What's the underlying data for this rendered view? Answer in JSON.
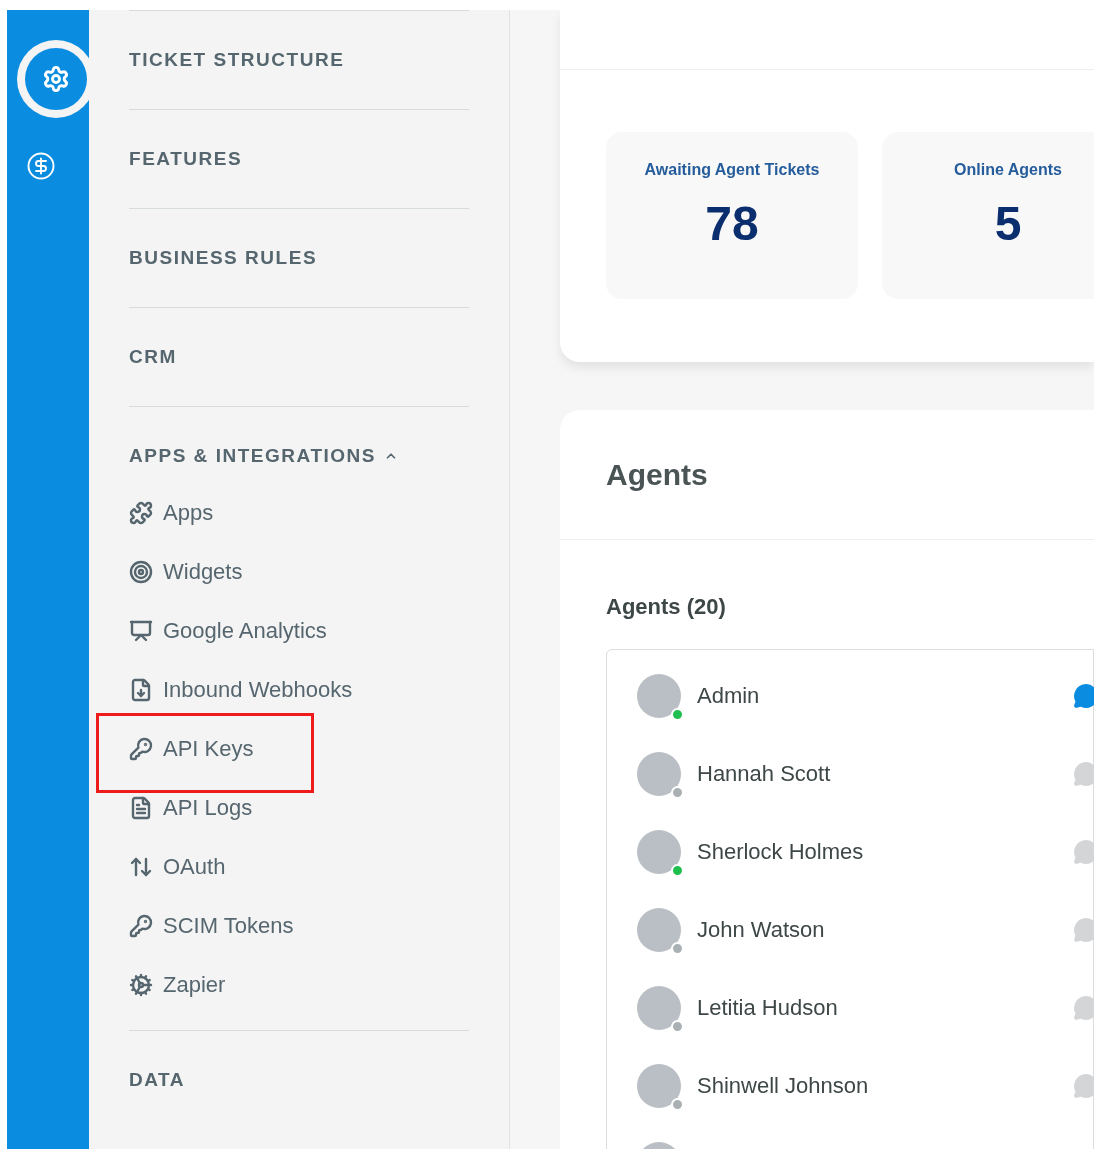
{
  "rail": {
    "items": [
      {
        "kind": "settings",
        "selected": true
      },
      {
        "kind": "billing",
        "selected": false
      }
    ]
  },
  "sidebar": {
    "sections": [
      {
        "title": "TICKET STRUCTURE",
        "expanded": false
      },
      {
        "title": "FEATURES",
        "expanded": false
      },
      {
        "title": "BUSINESS RULES",
        "expanded": false
      },
      {
        "title": "CRM",
        "expanded": false
      },
      {
        "title": "APPS & INTEGRATIONS",
        "expanded": true,
        "children": [
          {
            "label": "Apps",
            "kind": "puzzle",
            "highlighted": false
          },
          {
            "label": "Widgets",
            "kind": "widget",
            "highlighted": false
          },
          {
            "label": "Google Analytics",
            "kind": "chart",
            "highlighted": false
          },
          {
            "label": "Inbound Webhooks",
            "kind": "inbox",
            "highlighted": false
          },
          {
            "label": "API Keys",
            "kind": "key",
            "highlighted": true
          },
          {
            "label": "API Logs",
            "kind": "file",
            "highlighted": false
          },
          {
            "label": "OAuth",
            "kind": "arrows",
            "highlighted": false
          },
          {
            "label": "SCIM Tokens",
            "kind": "key",
            "highlighted": false
          },
          {
            "label": "Zapier",
            "kind": "gear",
            "highlighted": false
          }
        ]
      },
      {
        "title": "DATA",
        "expanded": false
      }
    ]
  },
  "stats": [
    {
      "label": "Awaiting Agent Tickets",
      "value": "78"
    },
    {
      "label": "Online Agents",
      "value": "5"
    }
  ],
  "agents_panel": {
    "title": "Agents",
    "list_title": "Agents (20)",
    "agents": [
      {
        "name": "Admin",
        "online": true,
        "chat_active": true
      },
      {
        "name": "Hannah Scott",
        "online": false,
        "chat_active": false
      },
      {
        "name": "Sherlock Holmes",
        "online": true,
        "chat_active": false
      },
      {
        "name": "John Watson",
        "online": false,
        "chat_active": false
      },
      {
        "name": "Letitia Hudson",
        "online": false,
        "chat_active": false
      },
      {
        "name": "Shinwell Johnson",
        "online": false,
        "chat_active": false
      }
    ]
  }
}
